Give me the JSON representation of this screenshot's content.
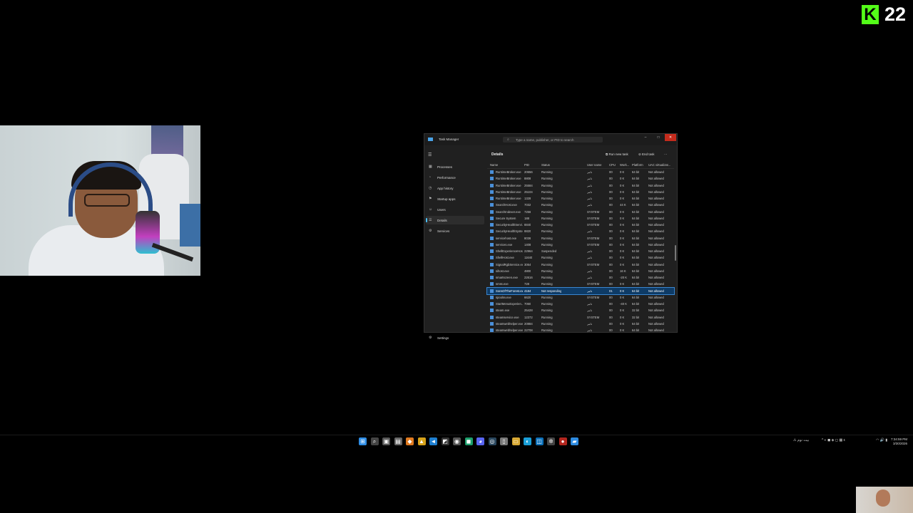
{
  "overlay": {
    "logo_letter": "K",
    "logo_number": "22"
  },
  "window": {
    "title": "Task Manager",
    "search_placeholder": "Type a name, publisher, or PID to search",
    "controls": {
      "minimize": "–",
      "maximize": "□",
      "close": "✕"
    }
  },
  "sidebar": {
    "items": [
      {
        "label": "Processes",
        "icon": "▦"
      },
      {
        "label": "Performance",
        "icon": "◔"
      },
      {
        "label": "App history",
        "icon": "◷"
      },
      {
        "label": "Startup apps",
        "icon": "⚑"
      },
      {
        "label": "Users",
        "icon": "☺"
      },
      {
        "label": "Details",
        "icon": "☰"
      },
      {
        "label": "Services",
        "icon": "⚙"
      }
    ],
    "settings_label": "Settings",
    "settings_icon": "⚙"
  },
  "page": {
    "title": "Details",
    "run_new_task": "Run new task",
    "end_task": "End task",
    "more": "⋯"
  },
  "table": {
    "columns": [
      "Name",
      "PID",
      "Status",
      "User name",
      "CPU",
      "Work...",
      "Platform",
      "UAC virtualizat..."
    ],
    "rows": [
      [
        "RuntimeBroker.exe",
        "20656",
        "Running",
        "تامر",
        "00",
        "0 K",
        "64 bit",
        "Not allowed"
      ],
      [
        "RuntimeBroker.exe",
        "8808",
        "Running",
        "تامر",
        "00",
        "0 K",
        "64 bit",
        "Not allowed"
      ],
      [
        "RuntimeBroker.exe",
        "25584",
        "Running",
        "تامر",
        "00",
        "0 K",
        "64 bit",
        "Not allowed"
      ],
      [
        "RuntimeBroker.exe",
        "25104",
        "Running",
        "تامر",
        "00",
        "0 K",
        "64 bit",
        "Not allowed"
      ],
      [
        "RuntimeBroker.exe",
        "1328",
        "Running",
        "تامر",
        "00",
        "0 K",
        "64 bit",
        "Not allowed"
      ],
      [
        "SearchHost.exe",
        "7032",
        "Running",
        "تامر",
        "00",
        "44 K",
        "64 bit",
        "Not allowed"
      ],
      [
        "SearchIndexer.exe",
        "7256",
        "Running",
        "SYSTEM",
        "00",
        "0 K",
        "64 bit",
        "Not allowed"
      ],
      [
        "Secure System",
        "188",
        "Running",
        "SYSTEM",
        "00",
        "0 K",
        "64 bit",
        "Not allowed"
      ],
      [
        "SecurityHealthServi...",
        "8840",
        "Running",
        "SYSTEM",
        "00",
        "0 K",
        "64 bit",
        "Not allowed"
      ],
      [
        "SecurityHealthSyste...",
        "8820",
        "Running",
        "تامر",
        "00",
        "0 K",
        "64 bit",
        "Not allowed"
      ],
      [
        "servicehost.exe",
        "8036",
        "Running",
        "SYSTEM",
        "00",
        "0 K",
        "64 bit",
        "Not allowed"
      ],
      [
        "services.exe",
        "1408",
        "Running",
        "SYSTEM",
        "00",
        "0 K",
        "64 bit",
        "Not allowed"
      ],
      [
        "ShellExperienceHos...",
        "22964",
        "Suspended",
        "تامر",
        "00",
        "0 K",
        "64 bit",
        "Not allowed"
      ],
      [
        "ShellHost.exe",
        "11640",
        "Running",
        "تامر",
        "00",
        "0 K",
        "64 bit",
        "Not allowed"
      ],
      [
        "SignalRgbService.exe",
        "3064",
        "Running",
        "SYSTEM",
        "00",
        "0 K",
        "64 bit",
        "Not allowed"
      ],
      [
        "sihost.exe",
        "4800",
        "Running",
        "تامر",
        "00",
        "16 K",
        "64 bit",
        "Not allowed"
      ],
      [
        "smartscreen.exe",
        "22616",
        "Running",
        "تامر",
        "00",
        "-20 K",
        "64 bit",
        "Not allowed"
      ],
      [
        "smss.exe",
        "728",
        "Running",
        "SYSTEM",
        "00",
        "0 K",
        "64 bit",
        "Not allowed"
      ],
      [
        "SonsOfTheForest.exe",
        "4184",
        "Not responding",
        "تامر",
        "01",
        "0 K",
        "64 bit",
        "Not allowed"
      ],
      [
        "spoolsv.exe",
        "6620",
        "Running",
        "SYSTEM",
        "00",
        "0 K",
        "64 bit",
        "Not allowed"
      ],
      [
        "StartMenuExperien...",
        "7060",
        "Running",
        "تامر",
        "00",
        "-40 K",
        "64 bit",
        "Not allowed"
      ],
      [
        "steam.exe",
        "25428",
        "Running",
        "تامر",
        "00",
        "0 K",
        "32 bit",
        "Not allowed"
      ],
      [
        "steamservice.exe",
        "12372",
        "Running",
        "SYSTEM",
        "00",
        "0 K",
        "32 bit",
        "Not allowed"
      ],
      [
        "steamwebhelper.exe",
        "20884",
        "Running",
        "تامر",
        "00",
        "0 K",
        "64 bit",
        "Not allowed"
      ],
      [
        "steamwebhelper.exe",
        "22708",
        "Running",
        "تامر",
        "00",
        "0 K",
        "64 bit",
        "Not allowed"
      ]
    ],
    "selected_index": 18
  },
  "taskbar": {
    "icons": [
      {
        "name": "start",
        "glyph": "⊞",
        "color": "#2f8de4"
      },
      {
        "name": "search",
        "glyph": "⌕",
        "color": "#444"
      },
      {
        "name": "task-view",
        "glyph": "▣",
        "color": "#555"
      },
      {
        "name": "files",
        "glyph": "▤",
        "color": "#666"
      },
      {
        "name": "app-orange",
        "glyph": "◆",
        "color": "#e07a1f"
      },
      {
        "name": "app-yellow",
        "glyph": "▲",
        "color": "#d6a21a"
      },
      {
        "name": "vscode",
        "glyph": "◄",
        "color": "#1e7fd0"
      },
      {
        "name": "app-dark",
        "glyph": "◩",
        "color": "#333"
      },
      {
        "name": "chrome",
        "glyph": "◉",
        "color": "#555"
      },
      {
        "name": "app-green",
        "glyph": "◼",
        "color": "#1b9e6b"
      },
      {
        "name": "discord",
        "glyph": "◕",
        "color": "#5865f2"
      },
      {
        "name": "steam",
        "glyph": "◎",
        "color": "#2a475e"
      },
      {
        "name": "notepad",
        "glyph": "▯",
        "color": "#777"
      },
      {
        "name": "explorer",
        "glyph": "▭",
        "color": "#d8a935"
      },
      {
        "name": "edge",
        "glyph": "◐",
        "color": "#1a9fd8"
      },
      {
        "name": "store",
        "glyph": "◫",
        "color": "#0b6fb8"
      },
      {
        "name": "gear",
        "glyph": "✲",
        "color": "#444"
      },
      {
        "name": "app-red",
        "glyph": "●",
        "color": "#b3261e"
      },
      {
        "name": "task-manager",
        "glyph": "▰",
        "color": "#2e8be0"
      }
    ],
    "weather_text": "⚠ بيت نوم",
    "tray_glyphs": "^  ◐  ◼  ◈  ◻  ▦  ε",
    "network": "◠ 🔊 ▮",
    "time": "7:34:59 PM",
    "date": "3/30/2026"
  }
}
